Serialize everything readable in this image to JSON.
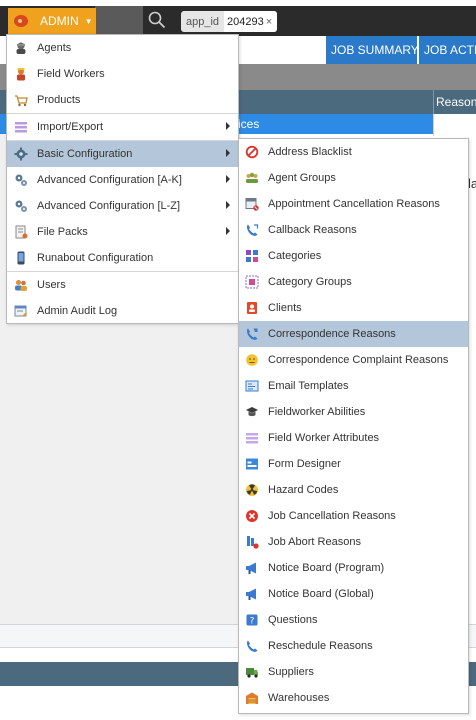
{
  "topbar": {
    "admin_label": "ADMIN",
    "appid_key": "app_id",
    "appid_value": "204293",
    "appid_clear": "×"
  },
  "nav": {
    "job_summary": "JOB SUMMARY",
    "job_actions": "JOB ACTIO"
  },
  "table": {
    "reason_header": "Reason",
    "selected_row_text": "ices",
    "side_text": "la"
  },
  "admin_menu": {
    "items": [
      {
        "label": "Agents",
        "icon": "agent-icon"
      },
      {
        "label": "Field Workers",
        "icon": "field-worker-icon"
      },
      {
        "label": "Products",
        "icon": "cart-icon"
      },
      {
        "label": "Import/Export",
        "icon": "list-icon"
      },
      {
        "label": "Basic Configuration",
        "icon": "gear-icon"
      },
      {
        "label": "Advanced Configuration [A-K]",
        "icon": "gears-icon"
      },
      {
        "label": "Advanced Configuration [L-Z]",
        "icon": "gears-icon"
      },
      {
        "label": "File Packs",
        "icon": "file-pack-icon"
      },
      {
        "label": "Runabout Configuration",
        "icon": "phone-icon"
      },
      {
        "label": "Users",
        "icon": "users-icon"
      },
      {
        "label": "Admin Audit Log",
        "icon": "audit-log-icon"
      }
    ]
  },
  "basic_config_menu": {
    "items": [
      {
        "label": "Address Blacklist",
        "icon": "no-entry-icon"
      },
      {
        "label": "Agent Groups",
        "icon": "agent-groups-icon"
      },
      {
        "label": "Appointment Cancellation Reasons",
        "icon": "calendar-cancel-icon"
      },
      {
        "label": "Callback Reasons",
        "icon": "callback-icon"
      },
      {
        "label": "Categories",
        "icon": "categories-icon"
      },
      {
        "label": "Category Groups",
        "icon": "category-groups-icon"
      },
      {
        "label": "Clients",
        "icon": "clients-icon"
      },
      {
        "label": "Correspondence Reasons",
        "icon": "correspondence-icon"
      },
      {
        "label": "Correspondence Complaint Reasons",
        "icon": "complaint-icon"
      },
      {
        "label": "Email Templates",
        "icon": "email-template-icon"
      },
      {
        "label": "Fieldworker Abilities",
        "icon": "graduation-cap-icon"
      },
      {
        "label": "Field Worker Attributes",
        "icon": "attributes-icon"
      },
      {
        "label": "Form Designer",
        "icon": "form-designer-icon"
      },
      {
        "label": "Hazard Codes",
        "icon": "hazard-icon"
      },
      {
        "label": "Job Cancellation Reasons",
        "icon": "cancel-icon"
      },
      {
        "label": "Job Abort Reasons",
        "icon": "abort-icon"
      },
      {
        "label": "Notice Board (Program)",
        "icon": "megaphone-icon"
      },
      {
        "label": "Notice Board (Global)",
        "icon": "megaphone-icon"
      },
      {
        "label": "Questions",
        "icon": "question-icon"
      },
      {
        "label": "Reschedule Reasons",
        "icon": "reschedule-icon"
      },
      {
        "label": "Suppliers",
        "icon": "truck-icon"
      },
      {
        "label": "Warehouses",
        "icon": "warehouse-icon"
      }
    ]
  },
  "colors": {
    "admin_orange": "#f0a21e",
    "nav_blue": "#2b79c9",
    "selection": "#b3c6da",
    "header_slate": "#4c6a7e"
  }
}
